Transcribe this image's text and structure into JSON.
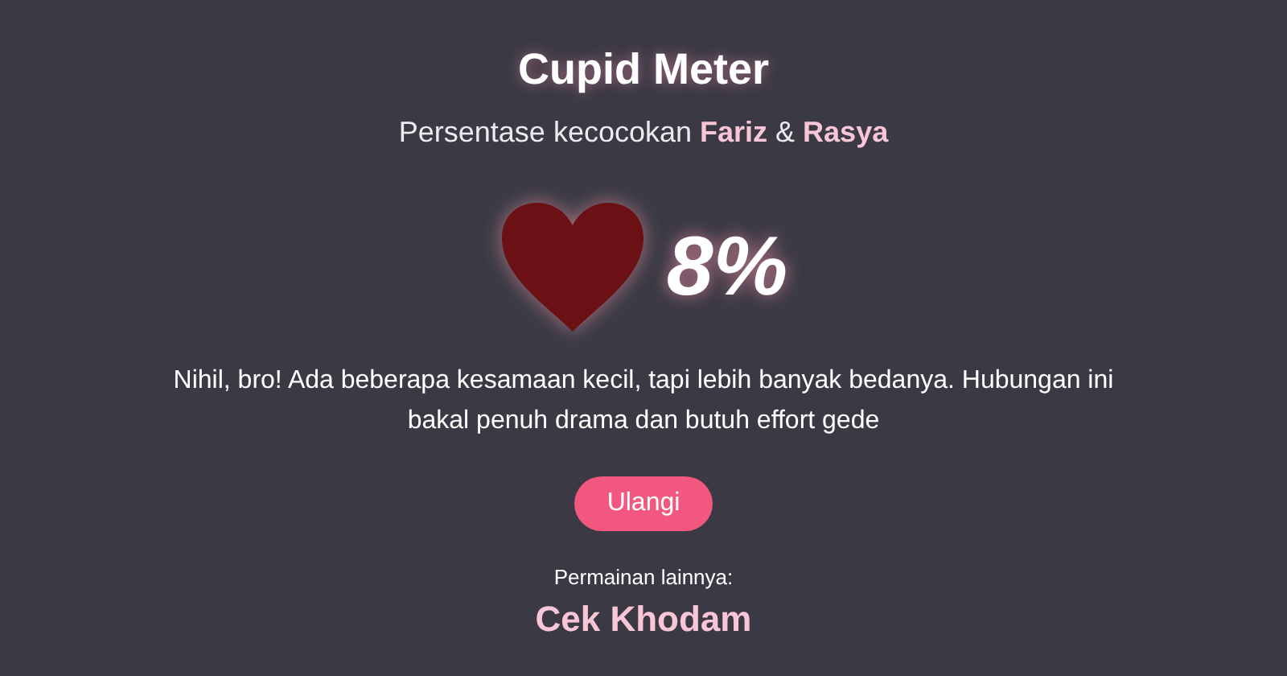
{
  "title": "Cupid Meter",
  "subtitle": "Persentase kecocokan **Fariz** & **Rasya**",
  "percentage": "8%",
  "message": "Nihil, bro! Ada beberapa kesamaan kecil, tapi lebih banyak bedanya. Hubungan ini bakal penuh drama dan butuh effort gede",
  "retry_button": "Ulangi",
  "other_games": {
    "label": "Permainan lainnya:",
    "link": "Cek Khodam"
  }
}
